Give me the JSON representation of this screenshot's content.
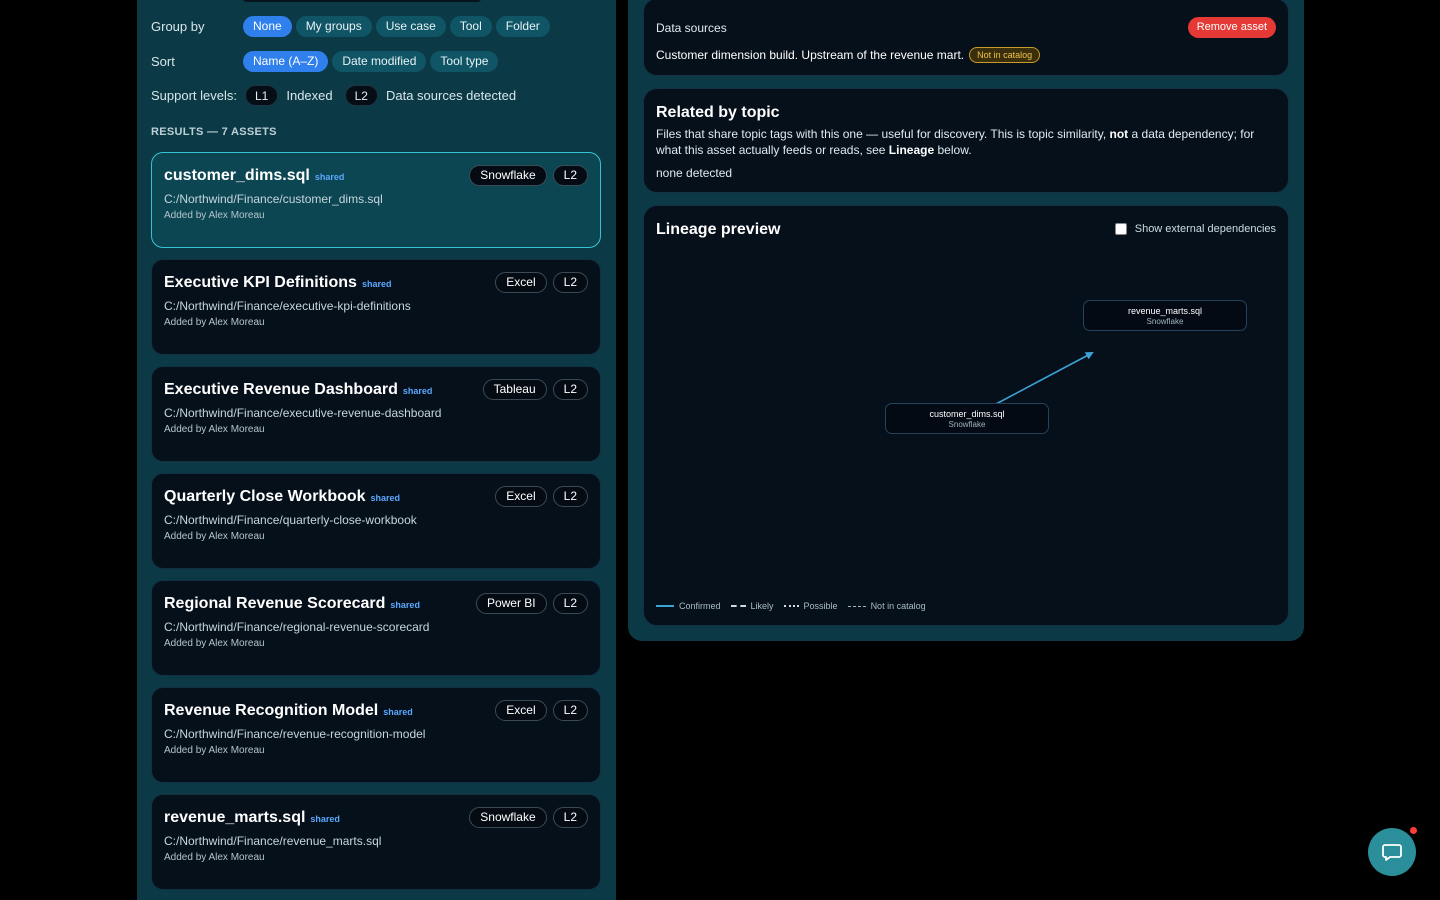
{
  "filters": {
    "group_by": {
      "label": "Group by",
      "options": [
        {
          "label": "None",
          "active": true
        },
        {
          "label": "My groups",
          "active": false
        },
        {
          "label": "Use case",
          "active": false
        },
        {
          "label": "Tool",
          "active": false
        },
        {
          "label": "Folder",
          "active": false
        }
      ]
    },
    "sort": {
      "label": "Sort",
      "options": [
        {
          "label": "Name (A–Z)",
          "active": true
        },
        {
          "label": "Date modified",
          "active": false
        },
        {
          "label": "Tool type",
          "active": false
        }
      ]
    },
    "support_levels": {
      "label": "Support levels:",
      "l1": "L1",
      "l1_desc": "Indexed",
      "l2": "L2",
      "l2_desc": "Data sources detected"
    }
  },
  "results": {
    "heading": "RESULTS — 7 ASSETS",
    "items": [
      {
        "title": "customer_dims.sql",
        "tag": "shared",
        "tool": "Snowflake",
        "level": "L2",
        "path": "C:/Northwind/Finance/customer_dims.sql",
        "added": "Added by Alex Moreau",
        "selected": true
      },
      {
        "title": "Executive KPI Definitions",
        "tag": "shared",
        "tool": "Excel",
        "level": "L2",
        "path": "C:/Northwind/Finance/executive-kpi-definitions",
        "added": "Added by Alex Moreau",
        "selected": false
      },
      {
        "title": "Executive Revenue Dashboard",
        "tag": "shared",
        "tool": "Tableau",
        "level": "L2",
        "path": "C:/Northwind/Finance/executive-revenue-dashboard",
        "added": "Added by Alex Moreau",
        "selected": false
      },
      {
        "title": "Quarterly Close Workbook",
        "tag": "shared",
        "tool": "Excel",
        "level": "L2",
        "path": "C:/Northwind/Finance/quarterly-close-workbook",
        "added": "Added by Alex Moreau",
        "selected": false
      },
      {
        "title": "Regional Revenue Scorecard",
        "tag": "shared",
        "tool": "Power BI",
        "level": "L2",
        "path": "C:/Northwind/Finance/regional-revenue-scorecard",
        "added": "Added by Alex Moreau",
        "selected": false
      },
      {
        "title": "Revenue Recognition Model",
        "tag": "shared",
        "tool": "Excel",
        "level": "L2",
        "path": "C:/Northwind/Finance/revenue-recognition-model",
        "added": "Added by Alex Moreau",
        "selected": false
      },
      {
        "title": "revenue_marts.sql",
        "tag": "shared",
        "tool": "Snowflake",
        "level": "L2",
        "path": "C:/Northwind/Finance/revenue_marts.sql",
        "added": "Added by Alex Moreau",
        "selected": false
      }
    ]
  },
  "detail": {
    "data_sources": {
      "label": "Data sources",
      "remove_label": "Remove asset",
      "description": "Customer dimension build. Upstream of the revenue mart.",
      "catalog_badge": "Not in catalog"
    },
    "related": {
      "title": "Related by topic",
      "desc_1": "Files that share topic tags with this one — useful for discovery. This is topic similarity,",
      "desc_not": "not",
      "desc_2": "a data dependency; for what this asset actually feeds or reads, see",
      "desc_lineage": "Lineage",
      "desc_3": "below.",
      "none_text": "none detected"
    },
    "lineage": {
      "title": "Lineage preview",
      "external_label": "Show external dependencies",
      "external_checked": false,
      "nodes": [
        {
          "name": "revenue_marts.sql",
          "tool": "Snowflake"
        },
        {
          "name": "customer_dims.sql",
          "tool": "Snowflake"
        }
      ],
      "edge_type": "Confirmed",
      "edge_color": "#3aa3d8",
      "legend": {
        "confirmed": "Confirmed",
        "likely": "Likely",
        "possible": "Possible",
        "not_in_catalog": "Not in catalog"
      }
    }
  },
  "chat": {
    "icon": "chat-bubble-icon",
    "has_notification": true
  },
  "colors": {
    "panel": "#0b3a46",
    "card": "#06101a",
    "accent": "#2f80ed",
    "danger": "#e53935",
    "warning": "#f2c24b",
    "selected_border": "#36c3d4"
  }
}
